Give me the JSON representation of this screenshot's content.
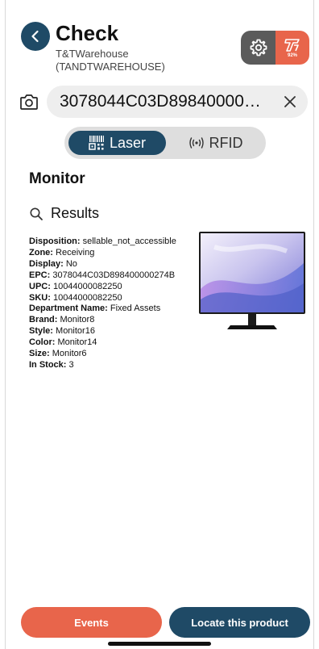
{
  "header": {
    "title": "Check",
    "location_name": "T&TWarehouse",
    "location_code": "(TANDTWAREHOUSE)",
    "brand_percent": "92%"
  },
  "search": {
    "value": "3078044C03D89840000…",
    "full_value": "3078044C03D898400000274B"
  },
  "mode_toggle": {
    "laser_label": "Laser",
    "rfid_label": "RFID",
    "selected": "Laser"
  },
  "product": {
    "title": "Monitor",
    "results_label": "Results",
    "image_icon": "monitor-image",
    "details": [
      {
        "label": "Disposition:",
        "value": "sellable_not_accessible"
      },
      {
        "label": "Zone:",
        "value": "Receiving"
      },
      {
        "label": "Display:",
        "value": "No"
      },
      {
        "label": "EPC:",
        "value": "3078044C03D898400000274B"
      },
      {
        "label": "UPC:",
        "value": "10044000082250"
      },
      {
        "label": "SKU:",
        "value": "10044000082250"
      },
      {
        "label": "Department Name:",
        "value": "Fixed Assets"
      },
      {
        "label": "Brand:",
        "value": "Monitor8"
      },
      {
        "label": "Style:",
        "value": "Monitor16"
      },
      {
        "label": "Color:",
        "value": "Monitor14"
      },
      {
        "label": "Size:",
        "value": "Monitor6"
      },
      {
        "label": "In Stock:",
        "value": "3"
      }
    ]
  },
  "actions": {
    "events_label": "Events",
    "locate_label": "Locate this product"
  },
  "colors": {
    "primary": "#1f4a66",
    "accent": "#e8654b",
    "settings": "#5b5b5b"
  }
}
